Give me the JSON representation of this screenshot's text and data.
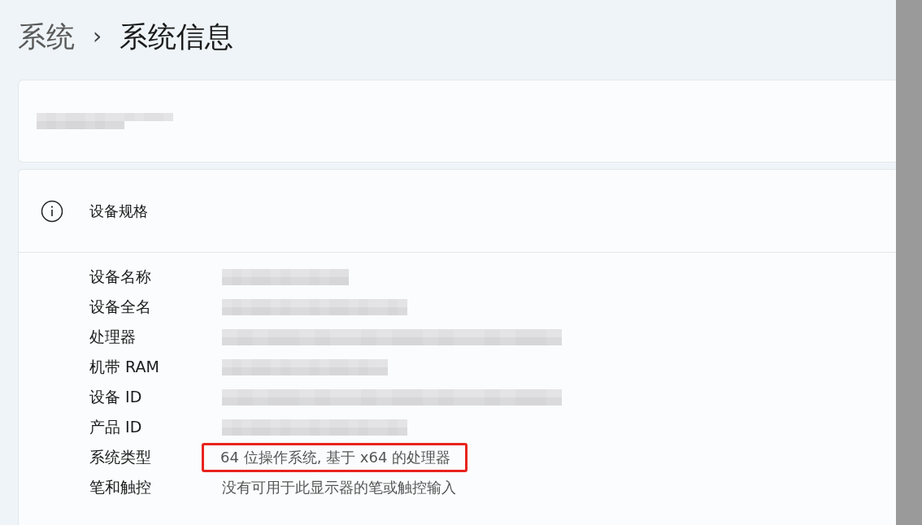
{
  "breadcrumb": {
    "parent": "系统",
    "separator": "›",
    "current": "系统信息"
  },
  "device_card": {
    "kind": "redacted"
  },
  "specs": {
    "title": "设备规格",
    "rows": [
      {
        "label": "设备名称",
        "kind": "redacted",
        "highlighted": false
      },
      {
        "label": "设备全名",
        "kind": "redacted",
        "highlighted": false
      },
      {
        "label": "处理器",
        "kind": "redacted",
        "highlighted": false
      },
      {
        "label": "机带 RAM",
        "kind": "redacted",
        "highlighted": false
      },
      {
        "label": "设备 ID",
        "kind": "redacted",
        "highlighted": false
      },
      {
        "label": "产品 ID",
        "kind": "redacted",
        "highlighted": false
      },
      {
        "label": "系统类型",
        "kind": "text",
        "value": "64 位操作系统, 基于 x64 的处理器",
        "highlighted": true
      },
      {
        "label": "笔和触控",
        "kind": "text",
        "value": "没有可用于此显示器的笔或触控输入",
        "highlighted": false
      }
    ]
  }
}
